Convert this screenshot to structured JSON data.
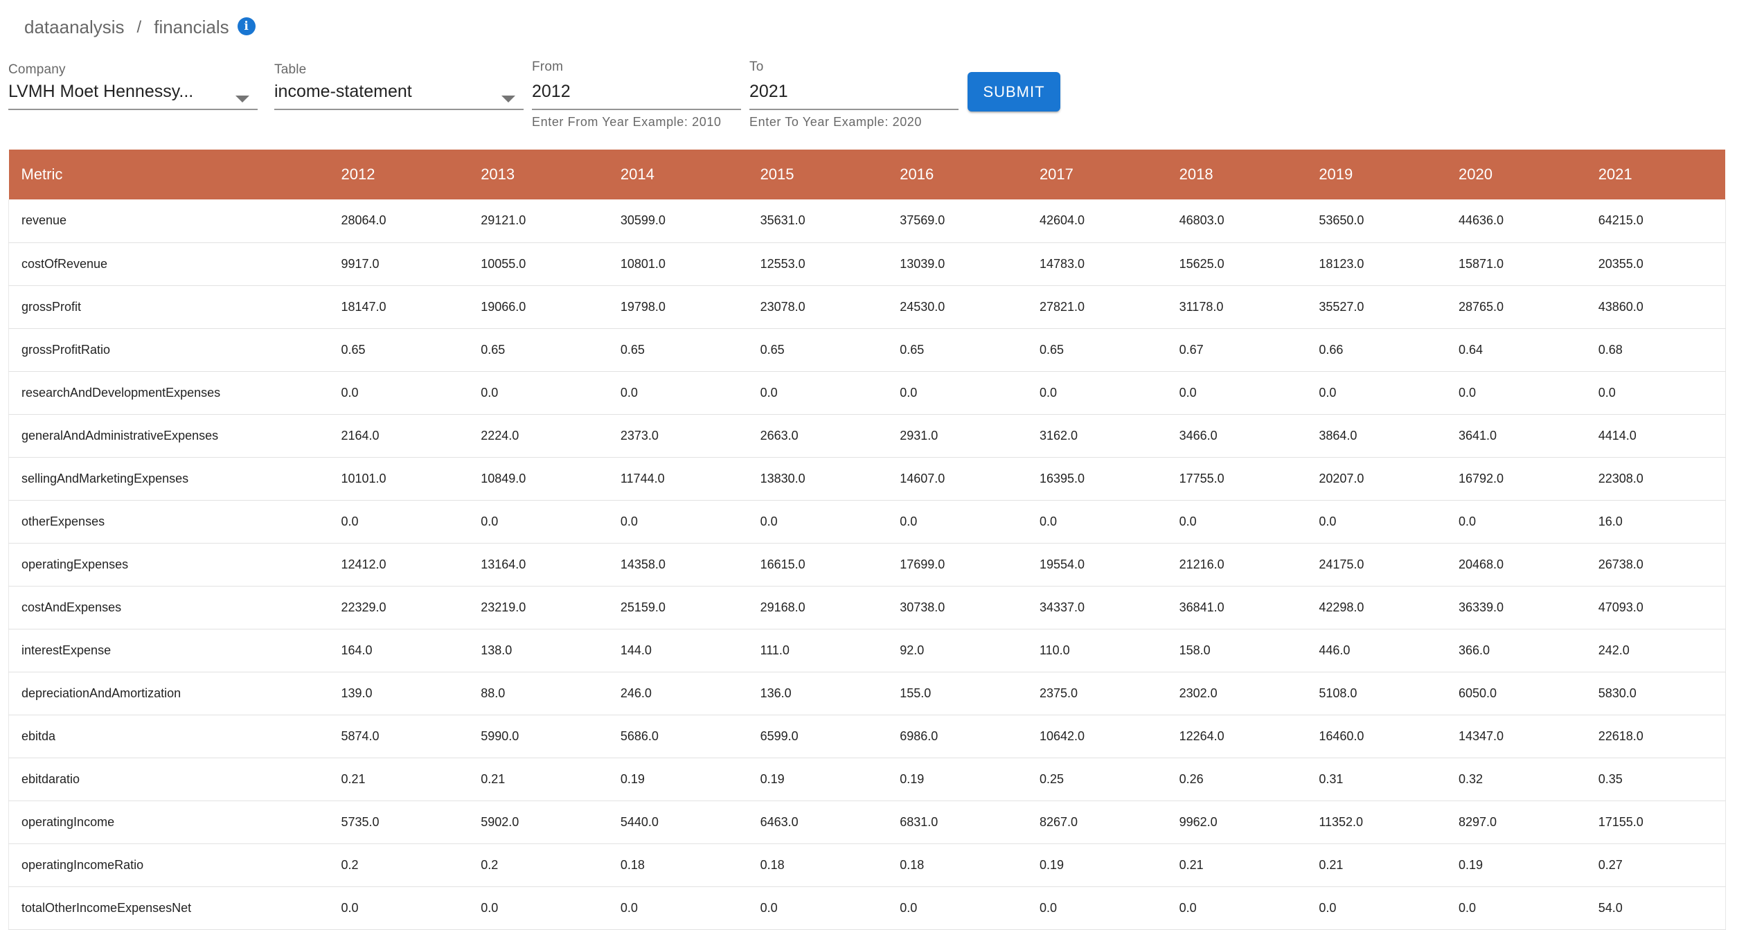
{
  "breadcrumb": {
    "root": "dataanalysis",
    "separator": "/",
    "current": "financials",
    "info_icon": "info-icon"
  },
  "filters": {
    "company": {
      "label": "Company",
      "value": "LVMH Moet Hennessy..."
    },
    "table": {
      "label": "Table",
      "value": "income-statement"
    },
    "from": {
      "label": "From",
      "value": "2012",
      "helper": "Enter From Year Example: 2010"
    },
    "to": {
      "label": "To",
      "value": "2021",
      "helper": "Enter To Year Example: 2020"
    },
    "submit_label": "SUBMIT"
  },
  "colors": {
    "header_bg": "#c8694a",
    "primary": "#1976d2"
  },
  "table": {
    "columns": [
      "Metric",
      "2012",
      "2013",
      "2014",
      "2015",
      "2016",
      "2017",
      "2018",
      "2019",
      "2020",
      "2021"
    ],
    "rows": [
      [
        "revenue",
        "28064.0",
        "29121.0",
        "30599.0",
        "35631.0",
        "37569.0",
        "42604.0",
        "46803.0",
        "53650.0",
        "44636.0",
        "64215.0"
      ],
      [
        "costOfRevenue",
        "9917.0",
        "10055.0",
        "10801.0",
        "12553.0",
        "13039.0",
        "14783.0",
        "15625.0",
        "18123.0",
        "15871.0",
        "20355.0"
      ],
      [
        "grossProfit",
        "18147.0",
        "19066.0",
        "19798.0",
        "23078.0",
        "24530.0",
        "27821.0",
        "31178.0",
        "35527.0",
        "28765.0",
        "43860.0"
      ],
      [
        "grossProfitRatio",
        "0.65",
        "0.65",
        "0.65",
        "0.65",
        "0.65",
        "0.65",
        "0.67",
        "0.66",
        "0.64",
        "0.68"
      ],
      [
        "researchAndDevelopmentExpenses",
        "0.0",
        "0.0",
        "0.0",
        "0.0",
        "0.0",
        "0.0",
        "0.0",
        "0.0",
        "0.0",
        "0.0"
      ],
      [
        "generalAndAdministrativeExpenses",
        "2164.0",
        "2224.0",
        "2373.0",
        "2663.0",
        "2931.0",
        "3162.0",
        "3466.0",
        "3864.0",
        "3641.0",
        "4414.0"
      ],
      [
        "sellingAndMarketingExpenses",
        "10101.0",
        "10849.0",
        "11744.0",
        "13830.0",
        "14607.0",
        "16395.0",
        "17755.0",
        "20207.0",
        "16792.0",
        "22308.0"
      ],
      [
        "otherExpenses",
        "0.0",
        "0.0",
        "0.0",
        "0.0",
        "0.0",
        "0.0",
        "0.0",
        "0.0",
        "0.0",
        "16.0"
      ],
      [
        "operatingExpenses",
        "12412.0",
        "13164.0",
        "14358.0",
        "16615.0",
        "17699.0",
        "19554.0",
        "21216.0",
        "24175.0",
        "20468.0",
        "26738.0"
      ],
      [
        "costAndExpenses",
        "22329.0",
        "23219.0",
        "25159.0",
        "29168.0",
        "30738.0",
        "34337.0",
        "36841.0",
        "42298.0",
        "36339.0",
        "47093.0"
      ],
      [
        "interestExpense",
        "164.0",
        "138.0",
        "144.0",
        "111.0",
        "92.0",
        "110.0",
        "158.0",
        "446.0",
        "366.0",
        "242.0"
      ],
      [
        "depreciationAndAmortization",
        "139.0",
        "88.0",
        "246.0",
        "136.0",
        "155.0",
        "2375.0",
        "2302.0",
        "5108.0",
        "6050.0",
        "5830.0"
      ],
      [
        "ebitda",
        "5874.0",
        "5990.0",
        "5686.0",
        "6599.0",
        "6986.0",
        "10642.0",
        "12264.0",
        "16460.0",
        "14347.0",
        "22618.0"
      ],
      [
        "ebitdaratio",
        "0.21",
        "0.21",
        "0.19",
        "0.19",
        "0.19",
        "0.25",
        "0.26",
        "0.31",
        "0.32",
        "0.35"
      ],
      [
        "operatingIncome",
        "5735.0",
        "5902.0",
        "5440.0",
        "6463.0",
        "6831.0",
        "8267.0",
        "9962.0",
        "11352.0",
        "8297.0",
        "17155.0"
      ],
      [
        "operatingIncomeRatio",
        "0.2",
        "0.2",
        "0.18",
        "0.18",
        "0.18",
        "0.19",
        "0.21",
        "0.21",
        "0.19",
        "0.27"
      ],
      [
        "totalOtherIncomeExpensesNet",
        "0.0",
        "0.0",
        "0.0",
        "0.0",
        "0.0",
        "0.0",
        "0.0",
        "0.0",
        "0.0",
        "54.0"
      ]
    ]
  }
}
